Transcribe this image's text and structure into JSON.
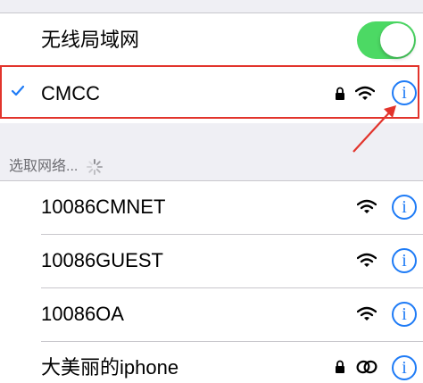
{
  "wlan": {
    "label": "无线局域网",
    "toggle_on": true
  },
  "connected": {
    "name": "CMCC",
    "locked": true
  },
  "section": {
    "title": "选取网络..."
  },
  "networks": [
    {
      "name": "10086CMNET",
      "locked": false,
      "icon": "wifi-icon"
    },
    {
      "name": "10086GUEST",
      "locked": false,
      "icon": "wifi-icon"
    },
    {
      "name": "10086OA",
      "locked": false,
      "icon": "wifi-icon"
    },
    {
      "name": "大美丽的iphone",
      "locked": true,
      "icon": "personal-hotspot-icon"
    }
  ],
  "colors": {
    "accent": "#1e7bf6",
    "toggle_on": "#4cd964",
    "annotation": "#e2342c"
  }
}
